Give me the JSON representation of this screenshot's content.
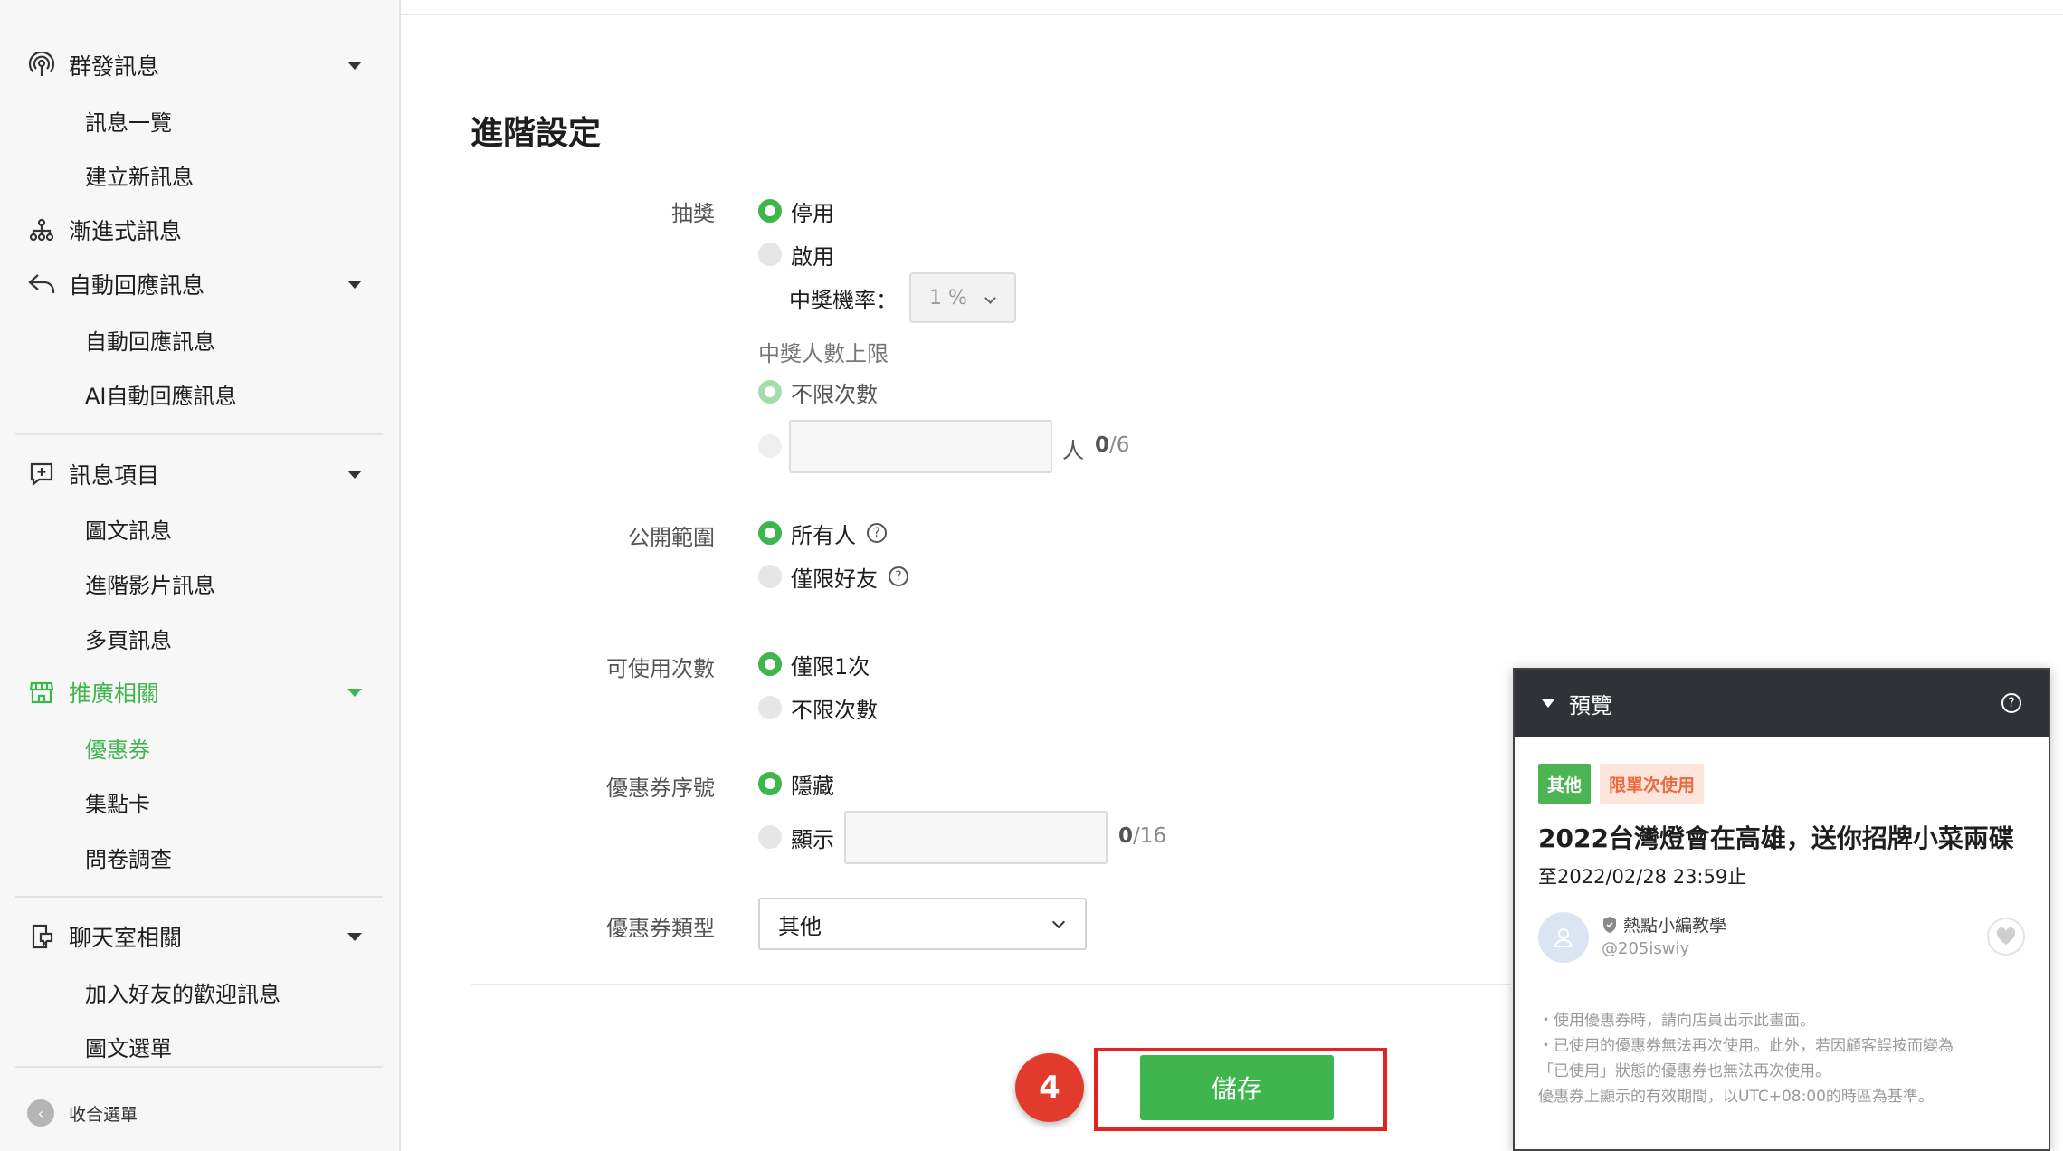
{
  "sidebar": {
    "groups": [
      {
        "label": "群發訊息",
        "icon": "broadcast-icon"
      },
      {
        "label": "漸進式訊息",
        "icon": "flow-icon"
      },
      {
        "label": "自動回應訊息",
        "icon": "reply-icon"
      },
      {
        "label": "訊息項目",
        "icon": "message-plus-icon"
      },
      {
        "label": "推廣相關",
        "icon": "store-icon"
      },
      {
        "label": "聊天室相關",
        "icon": "chat-room-icon"
      }
    ],
    "items": {
      "message_list": "訊息一覽",
      "create_message": "建立新訊息",
      "auto_reply": "自動回應訊息",
      "ai_auto_reply": "AI自動回應訊息",
      "rich_message": "圖文訊息",
      "rich_video": "進階影片訊息",
      "card_message": "多頁訊息",
      "coupon": "優惠券",
      "reward_card": "集點卡",
      "survey": "問卷調查",
      "greeting": "加入好友的歡迎訊息",
      "rich_menu": "圖文選單"
    },
    "collapse_label": "收合選單"
  },
  "form": {
    "section_title": "進階設定",
    "lottery": {
      "label": "抽獎",
      "options": [
        "停用",
        "啟用"
      ],
      "selected": "停用",
      "rate_label": "中獎機率：",
      "rate_value": "1 %",
      "winners_label": "中獎人數上限",
      "winners_options": [
        "不限次數"
      ],
      "winners_unit": "人",
      "winners_count": "0",
      "winners_max": "/6"
    },
    "visibility": {
      "label": "公開範圍",
      "options": [
        "所有人",
        "僅限好友"
      ],
      "selected": "所有人"
    },
    "usage": {
      "label": "可使用次數",
      "options": [
        "僅限1次",
        "不限次數"
      ],
      "selected": "僅限1次"
    },
    "serial": {
      "label": "優惠券序號",
      "options": [
        "隱藏",
        "顯示"
      ],
      "selected": "隱藏",
      "count": "0",
      "max": "/16"
    },
    "coupon_type": {
      "label": "優惠券類型",
      "value": "其他"
    },
    "save_label": "儲存",
    "step_number": "4"
  },
  "preview": {
    "header": "預覽",
    "tags": [
      "其他",
      "限單次使用"
    ],
    "title": "2022台灣燈會在高雄，送你招牌小菜兩碟",
    "date": "至2022/02/28 23:59止",
    "account_name": "熱點小編教學",
    "account_id": "@205iswiy",
    "notes": [
      "・使用優惠券時，請向店員出示此畫面。",
      "・已使用的優惠券無法再次使用。此外，若因顧客誤按而變為",
      "「已使用」狀態的優惠券也無法再次使用。",
      "優惠券上顯示的有效期間，以UTC+08:00的時區為基準。"
    ]
  },
  "colors": {
    "accent": "#3fb64d",
    "highlight": "#e3241e",
    "badge": "#e23a2c",
    "preview_header": "#2f3337"
  }
}
